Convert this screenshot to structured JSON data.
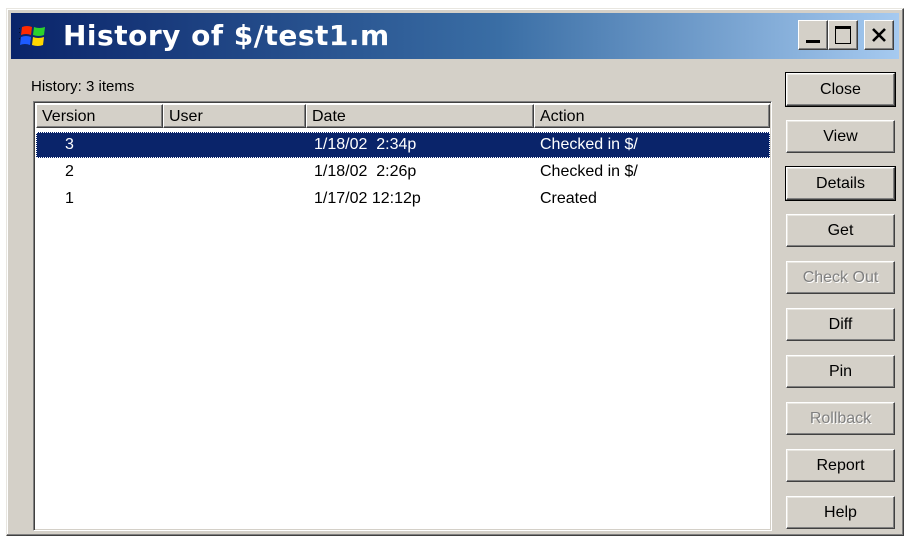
{
  "window": {
    "title": "History of $/test1.m",
    "title_icon": "windows-flag-icon"
  },
  "titlebar_buttons": {
    "minimize": "minimize-icon",
    "maximize": "maximize-icon",
    "close": "close-icon"
  },
  "history": {
    "count_label": "History: 3 items",
    "columns": {
      "version": "Version",
      "user": "User",
      "date": "Date",
      "action": "Action"
    },
    "rows": [
      {
        "version": "3",
        "user": "",
        "date": "1/18/02  2:34p",
        "action": "Checked in $/",
        "selected": true
      },
      {
        "version": "2",
        "user": "",
        "date": "1/18/02  2:26p",
        "action": "Checked in $/",
        "selected": false
      },
      {
        "version": "1",
        "user": "",
        "date": "1/17/02 12:12p",
        "action": "Created",
        "selected": false
      }
    ]
  },
  "buttons": {
    "close": "Close",
    "view": "View",
    "details": "Details",
    "get": "Get",
    "check_out": "Check Out",
    "diff": "Diff",
    "pin": "Pin",
    "rollback": "Rollback",
    "report": "Report",
    "help": "Help"
  },
  "colors": {
    "title_gradient_start": "#0a246a",
    "title_gradient_end": "#a6caf0",
    "selection": "#0a246a",
    "face": "#d4d0c8"
  }
}
